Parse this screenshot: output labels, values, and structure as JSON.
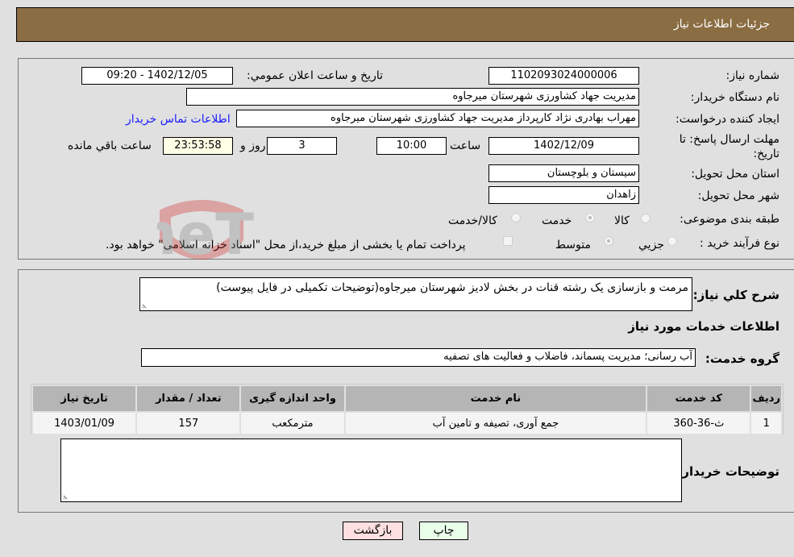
{
  "header": {
    "title": "جزئیات اطلاعات نیاز"
  },
  "form": {
    "need_number": {
      "label": "شماره نیاز:",
      "value": "1102093024000006"
    },
    "announce_datetime": {
      "label": "تاریخ و ساعت اعلان عمومي:",
      "value": "1402/12/05 - 09:20"
    },
    "buyer_org": {
      "label": "نام دستگاه خریدار:",
      "value": "مدیریت جهاد کشاورزی شهرستان میرجاوه"
    },
    "requester": {
      "label": "ایجاد کننده درخواست:",
      "value": "مهراب بهادری نژاد کارپرداز مدیریت جهاد کشاورزی شهرستان میرجاوه"
    },
    "buyer_contact_link": "اطلاعات تماس خریدار",
    "deadline": {
      "label": "مهلت ارسال پاسخ: تا تاریخ:",
      "date": "1402/12/09",
      "time_label": "ساعت",
      "time": "10:00",
      "days": "3",
      "days_label": "روز و",
      "remaining": "23:53:58",
      "remaining_label": "ساعت باقي مانده"
    },
    "province": {
      "label": "استان محل تحویل:",
      "value": "سیستان و بلوچستان"
    },
    "city": {
      "label": "شهر محل تحویل:",
      "value": "زاهدان"
    },
    "category": {
      "label": "طبقه بندی موضوعی:",
      "options": [
        "کالا",
        "خدمت",
        "کالا/خدمت"
      ],
      "selected": "خدمت"
    },
    "purchase_type": {
      "label": "نوع فرآیند خرید :",
      "options": [
        "جزيي",
        "متوسط"
      ],
      "selected": "متوسط",
      "treasury_note": "پرداخت تمام یا بخشی از مبلغ خرید،از محل \"اسناد خزانه اسلامی\" خواهد بود."
    }
  },
  "description": {
    "label": "شرح كلي نياز:",
    "value": "مرمت و بازسازی یک رشته قنات در بخش لادیز شهرستان میرجاوه(توضیحات تکمیلی در فایل پیوست)"
  },
  "services_section": {
    "title": "اطلاعات خدمات مورد نیاز",
    "group_label": "گروه خدمت:",
    "group_value": "آب رسانی؛ مدیریت پسماند، فاضلاب و فعالیت های تصفیه",
    "table": {
      "headers": [
        "ردیف",
        "کد خدمت",
        "نام خدمت",
        "واحد اندازه گیری",
        "تعداد / مقدار",
        "تاریخ نیاز"
      ],
      "rows": [
        [
          "1",
          "ث-36-360",
          "جمع آوری، تصیفه و تامین آب",
          "مترمکعب",
          "157",
          "1403/01/09"
        ]
      ]
    }
  },
  "buyer_notes": {
    "label": "توضیحات خریدار:",
    "value": ""
  },
  "buttons": {
    "print": "چاپ",
    "back": "بازگشت"
  },
  "colors": {
    "header_bg": "#8b6d43",
    "print_bg": "#eaffea",
    "back_bg": "#ffe0e0",
    "link": "#1a1aff"
  }
}
